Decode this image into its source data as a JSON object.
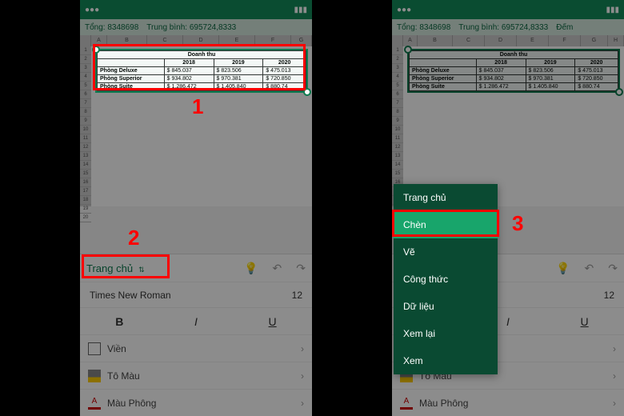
{
  "summary": {
    "sum_label": "Tổng: 8348698",
    "avg_label": "Trung bình: 695724,8333",
    "count_label": "Đếm"
  },
  "columns": [
    "A",
    "B",
    "C",
    "D",
    "E",
    "F",
    "G",
    "H"
  ],
  "chart_data": {
    "type": "table",
    "title": "Doanh thu",
    "headers": [
      "",
      "2018",
      "2019",
      "2020"
    ],
    "rows": [
      {
        "label": "Phòng Deluxe",
        "values": [
          "$ 845.037",
          "$ 823.506",
          "$ 475.013"
        ]
      },
      {
        "label": "Phòng Superior",
        "values": [
          "$ 934.802",
          "$ 970.381",
          "$ 720.850"
        ]
      },
      {
        "label": "Phòng Suite",
        "values": [
          "$ 1.286.472",
          "$ 1.405.840",
          "$ 880.74"
        ]
      }
    ]
  },
  "toolbar": {
    "tab": "Trang chủ",
    "font_name": "Times New Roman",
    "font_size": "12",
    "bold": "B",
    "italic": "I",
    "underline": "U",
    "border_label": "Viền",
    "fill_label": "Tô Màu",
    "fontcolor_label": "Màu Phông"
  },
  "menu": {
    "items": [
      "Trang chủ",
      "Chèn",
      "Vẽ",
      "Công thức",
      "Dữ liệu",
      "Xem lại",
      "Xem"
    ],
    "active": "Chèn"
  },
  "callouts": {
    "c1": "1",
    "c2": "2",
    "c3": "3"
  }
}
